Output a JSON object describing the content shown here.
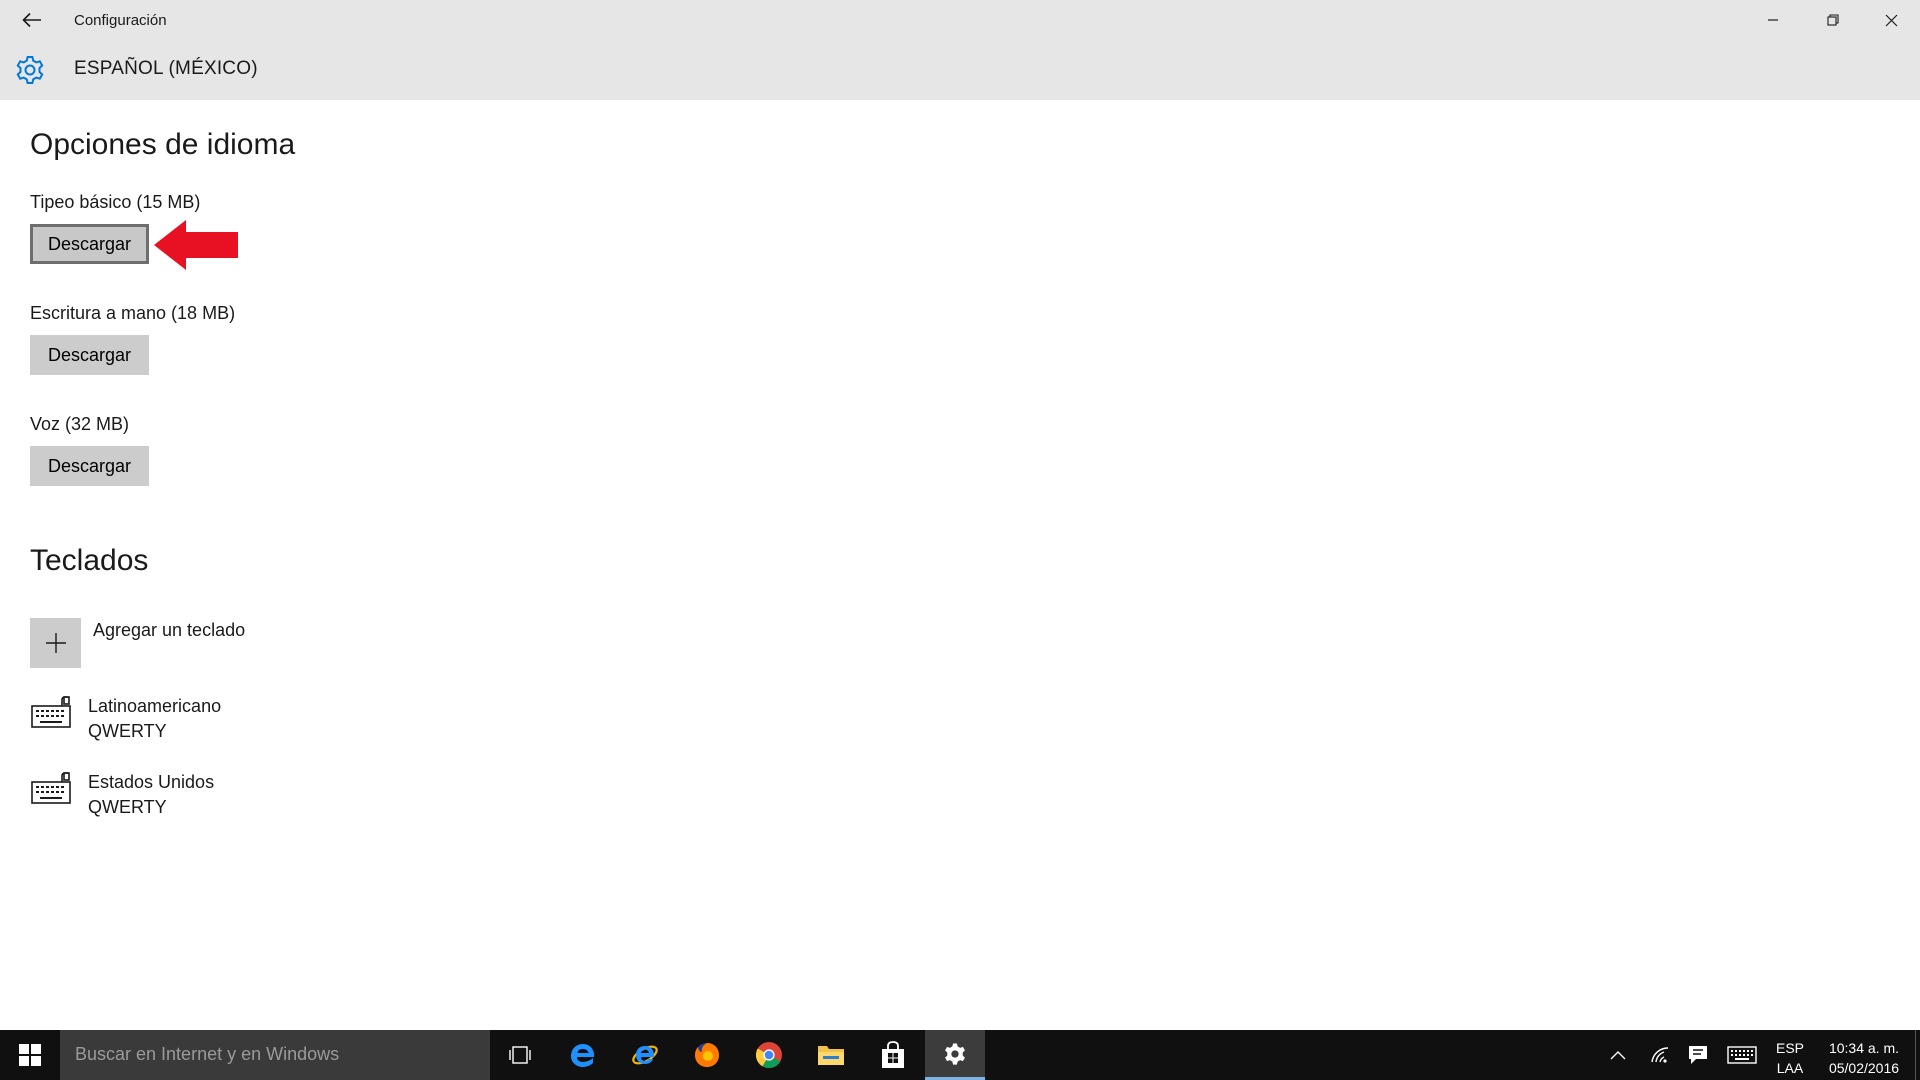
{
  "window": {
    "app_title": "Configuración",
    "section_title": "ESPAÑOL (MÉXICO)"
  },
  "language_options": {
    "heading": "Opciones de idioma",
    "items": [
      {
        "label": "Tipeo básico (15 MB)",
        "button": "Descargar"
      },
      {
        "label": "Escritura a mano (18 MB)",
        "button": "Descargar"
      },
      {
        "label": "Voz (32 MB)",
        "button": "Descargar"
      }
    ]
  },
  "keyboards": {
    "heading": "Teclados",
    "add_label": "Agregar un teclado",
    "items": [
      {
        "name": "Latinoamericano",
        "layout": "QWERTY"
      },
      {
        "name": "Estados Unidos",
        "layout": "QWERTY"
      }
    ]
  },
  "taskbar": {
    "search_placeholder": "Buscar en Internet y en Windows",
    "language_code": "ESP",
    "layout_code": "LAA",
    "time": "10:34 a. m.",
    "date": "05/02/2016",
    "pinned_icons": [
      "task-view-icon",
      "edge-icon",
      "internet-explorer-icon",
      "firefox-icon",
      "chrome-icon",
      "file-explorer-icon",
      "store-icon",
      "settings-icon"
    ]
  },
  "colors": {
    "title_bar": "#e6e6e6",
    "accent": "#0078d7",
    "button": "#cccccc",
    "annotation_arrow": "#e81123",
    "taskbar": "#101010"
  }
}
